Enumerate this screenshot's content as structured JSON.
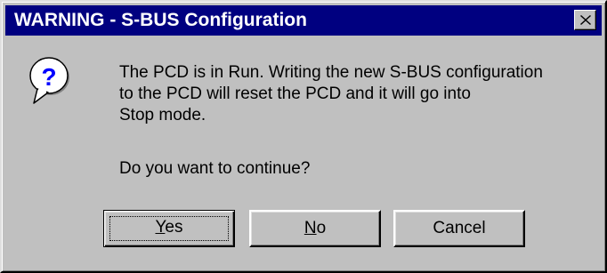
{
  "window": {
    "title": "WARNING - S-BUS Configuration",
    "close_icon": "close-x-icon"
  },
  "message": {
    "icon": "question-balloon-icon",
    "lines": [
      "The PCD is in Run. Writing the new S-BUS configuration",
      "to the PCD will reset the PCD and it will go into",
      "Stop mode."
    ],
    "question": "Do you want to continue?"
  },
  "buttons": {
    "yes_mnemonic": "Y",
    "yes_rest": "es",
    "no_mnemonic": "N",
    "no_rest": "o",
    "cancel_label": "Cancel"
  },
  "colors": {
    "titlebar": "#000080",
    "face": "#c0c0c0",
    "icon_blue": "#0000ff"
  }
}
